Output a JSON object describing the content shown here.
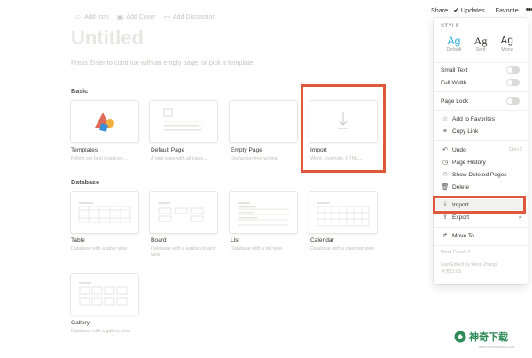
{
  "topbar": {
    "share": "Share",
    "updates": "Updates",
    "favorite": "Favorite",
    "more": "•••"
  },
  "page": {
    "add_icon": "Add Icon",
    "add_cover": "Add Cover",
    "add_discussion": "Add Discussion",
    "title": "Untitled",
    "hint": "Press Enter to continue with an empty page, or pick a template."
  },
  "sections": {
    "basic": "Basic",
    "database": "Database"
  },
  "basic_cards": [
    {
      "name": "Templates",
      "desc": "Follow our best practices…"
    },
    {
      "name": "Default Page",
      "desc": "A new page with all class..."
    },
    {
      "name": "Empty Page",
      "desc": "Distraction-free writing"
    },
    {
      "name": "Import",
      "desc": "Word, Evernote, HTML..."
    }
  ],
  "database_cards": [
    {
      "name": "Table",
      "desc": "Database with a table view"
    },
    {
      "name": "Board",
      "desc": "Database with a kanban board view"
    },
    {
      "name": "List",
      "desc": "Database with a list view"
    },
    {
      "name": "Calendar",
      "desc": "Database with a calendar view"
    },
    {
      "name": "Gallery",
      "desc": "Database with a gallery view"
    }
  ],
  "menu": {
    "style_label": "STYLE",
    "styles": [
      {
        "glyph": "Ag",
        "label": "Default",
        "selected": true
      },
      {
        "glyph": "Ag",
        "label": "Serif",
        "selected": false
      },
      {
        "glyph": "Ag",
        "label": "Mono",
        "selected": false
      }
    ],
    "small_text": "Small Text",
    "full_width": "Full Width",
    "page_lock": "Page Lock",
    "add_favorites": "Add to Favorites",
    "copy_link": "Copy Link",
    "undo": "Undo",
    "undo_shortcut": "Ctrl+Z",
    "page_history": "Page History",
    "show_deleted": "Show Deleted Pages",
    "delete": "Delete",
    "import": "Import",
    "export": "Export",
    "move_to": "Move To",
    "footer_count": "Word Count: 0",
    "footer_edit": "Last Edited by Henri Zhang",
    "footer_time": "今天11:05"
  },
  "watermark": {
    "text": "神奇下载",
    "sub": "www.shenqixiazai.com"
  },
  "colors": {
    "highlight": "#e0583a",
    "accent_blue": "#2eaadc",
    "watermark_green": "#2e8b57"
  }
}
